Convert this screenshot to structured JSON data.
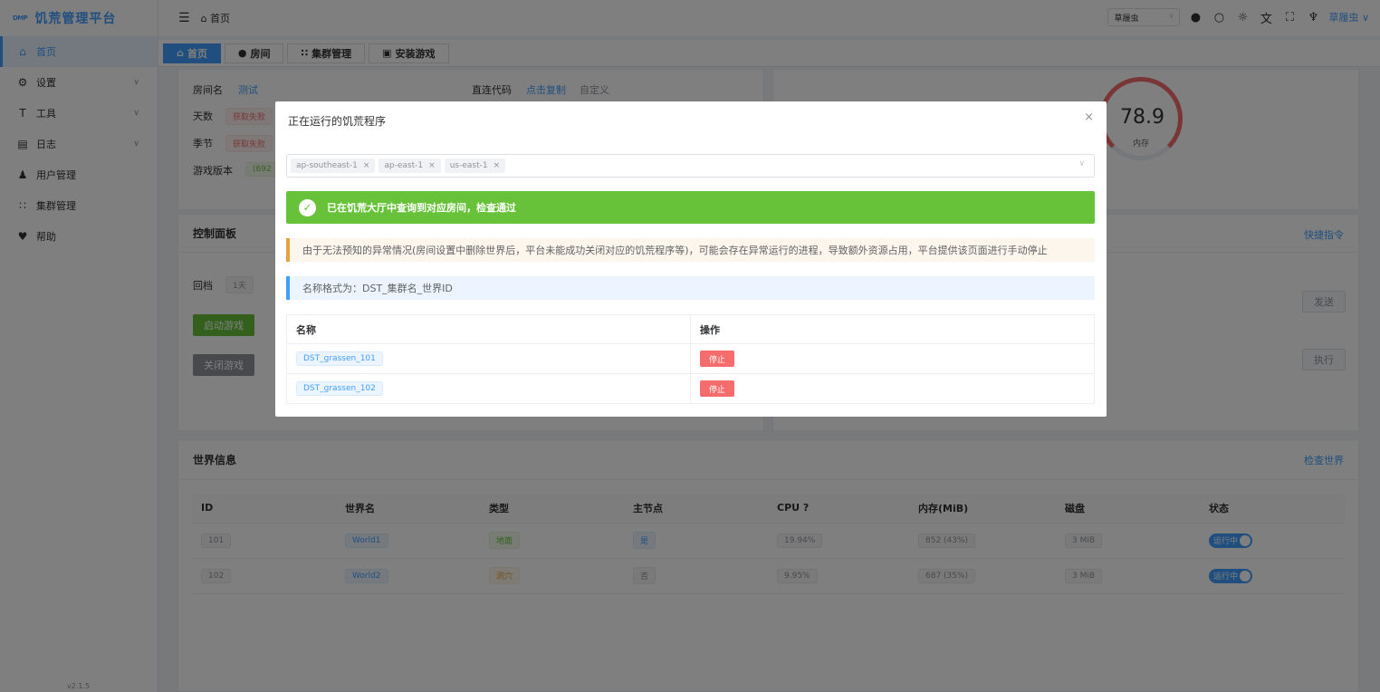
{
  "sidebar": {
    "logo_text": "DMP",
    "title": "饥荒管理平台",
    "items": [
      {
        "label": "首页",
        "icon": "home-icon",
        "active": true
      },
      {
        "label": "设置",
        "icon": "gear-icon",
        "expandable": true
      },
      {
        "label": "工具",
        "icon": "tool-icon",
        "expandable": true
      },
      {
        "label": "日志",
        "icon": "log-icon",
        "expandable": true
      },
      {
        "label": "用户管理",
        "icon": "user-icon"
      },
      {
        "label": "集群管理",
        "icon": "cluster-icon"
      },
      {
        "label": "帮助",
        "icon": "help-icon"
      }
    ],
    "version": "v2.1.5"
  },
  "header": {
    "breadcrumb": "首页",
    "cluster_select": "草履虫",
    "username": "草履虫"
  },
  "tabs": [
    "首页",
    "房间",
    "集群管理",
    "安装游戏"
  ],
  "room_card": {
    "room_name_label": "房间名",
    "room_name_value": "测试",
    "direct_label": "直连代码",
    "copy_link": "点击复制",
    "custom_link": "自定义",
    "days_label": "天数",
    "days_value": "获取失败",
    "season_label": "季节",
    "season_value": "获取失败",
    "version_label": "游戏版本",
    "version_value": "(692"
  },
  "stats_card": {
    "memory_value": "78.9",
    "memory_label": "内存"
  },
  "control_card": {
    "title": "控制面板",
    "rollback_label": "回档",
    "rollback_day": "1天",
    "start_button": "启动游戏",
    "stop_button": "关闭游戏"
  },
  "command_card": {
    "quick_link": "快捷指令",
    "send_button": "发送",
    "exec_button": "执行"
  },
  "world_card": {
    "title": "世界信息",
    "check_link": "检查世界",
    "columns": [
      "ID",
      "世界名",
      "类型",
      "主节点",
      "CPU",
      "内存(MiB)",
      "磁盘",
      "状态"
    ],
    "rows": [
      {
        "id": "101",
        "name": "World1",
        "type": "地面",
        "master": "是",
        "cpu": "19.94%",
        "mem": "852 (43%)",
        "disk": "3 MiB",
        "status": "运行中"
      },
      {
        "id": "102",
        "name": "World2",
        "type": "洞穴",
        "master": "否",
        "cpu": "9.95%",
        "mem": "687 (35%)",
        "disk": "3 MiB",
        "status": "运行中"
      }
    ]
  },
  "dialog": {
    "title": "正在运行的饥荒程序",
    "regions": [
      "ap-southeast-1",
      "ap-east-1",
      "us-east-1"
    ],
    "success_text": "已在饥荒大厅中查询到对应房间，检查通过",
    "warning_text": "由于无法预知的异常情况(房间设置中删除世界后，平台未能成功关闭对应的饥荒程序等)，可能会存在异常运行的进程，导致额外资源占用，平台提供该页面进行手动停止",
    "info_text": "名称格式为：DST_集群名_世界ID",
    "columns": [
      "名称",
      "操作"
    ],
    "rows": [
      {
        "name": "DST_grassen_101",
        "action": "停止"
      },
      {
        "name": "DST_grassen_102",
        "action": "停止"
      }
    ]
  }
}
